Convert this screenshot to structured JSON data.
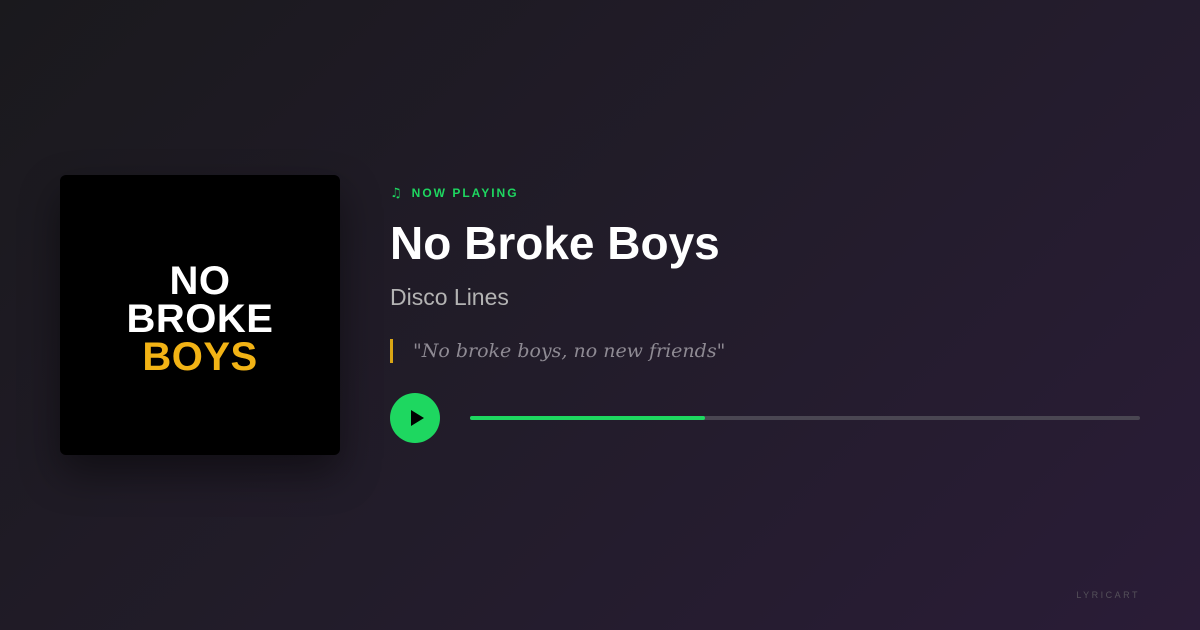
{
  "cover": {
    "line1": "NO",
    "line2": "BROKE",
    "line3": "BOYS",
    "accent_color": "#f2b315"
  },
  "now_playing": {
    "icon": "music-note-icon",
    "label": "NOW PLAYING"
  },
  "track": {
    "title": "No Broke Boys",
    "artist": "Disco Lines",
    "lyric": "\"No broke boys, no new friends\""
  },
  "player": {
    "play_icon": "play-icon",
    "progress": 0.35,
    "accent_color": "#1ed760"
  },
  "brand": {
    "label": "LYRICART"
  }
}
